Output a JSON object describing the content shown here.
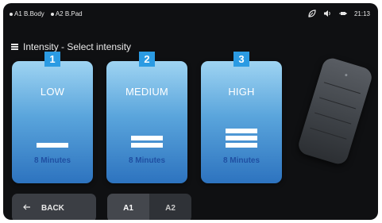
{
  "status": {
    "devices": [
      {
        "label": "A1 B.Body"
      },
      {
        "label": "A2 B.Pad"
      }
    ],
    "time": "21:13",
    "icons": [
      "leaf-icon",
      "volume-icon",
      "battery-icon"
    ]
  },
  "header": {
    "title": "Intensity - Select intensity"
  },
  "cards": [
    {
      "number": "1",
      "title": "LOW",
      "duration": "8 Minutes",
      "level": 1
    },
    {
      "number": "2",
      "title": "MEDIUM",
      "duration": "8 Minutes",
      "level": 2
    },
    {
      "number": "3",
      "title": "HIGH",
      "duration": "8 Minutes",
      "level": 3
    }
  ],
  "footer": {
    "back_label": "BACK",
    "toggle": {
      "options": [
        "A1",
        "A2"
      ],
      "selected": "A1"
    }
  },
  "colors": {
    "badge": "#2b9be3",
    "card_top": "#9fd4f2",
    "card_bottom": "#2d73bf",
    "duration_text": "#1f4fa2",
    "background": "#0f1012"
  }
}
